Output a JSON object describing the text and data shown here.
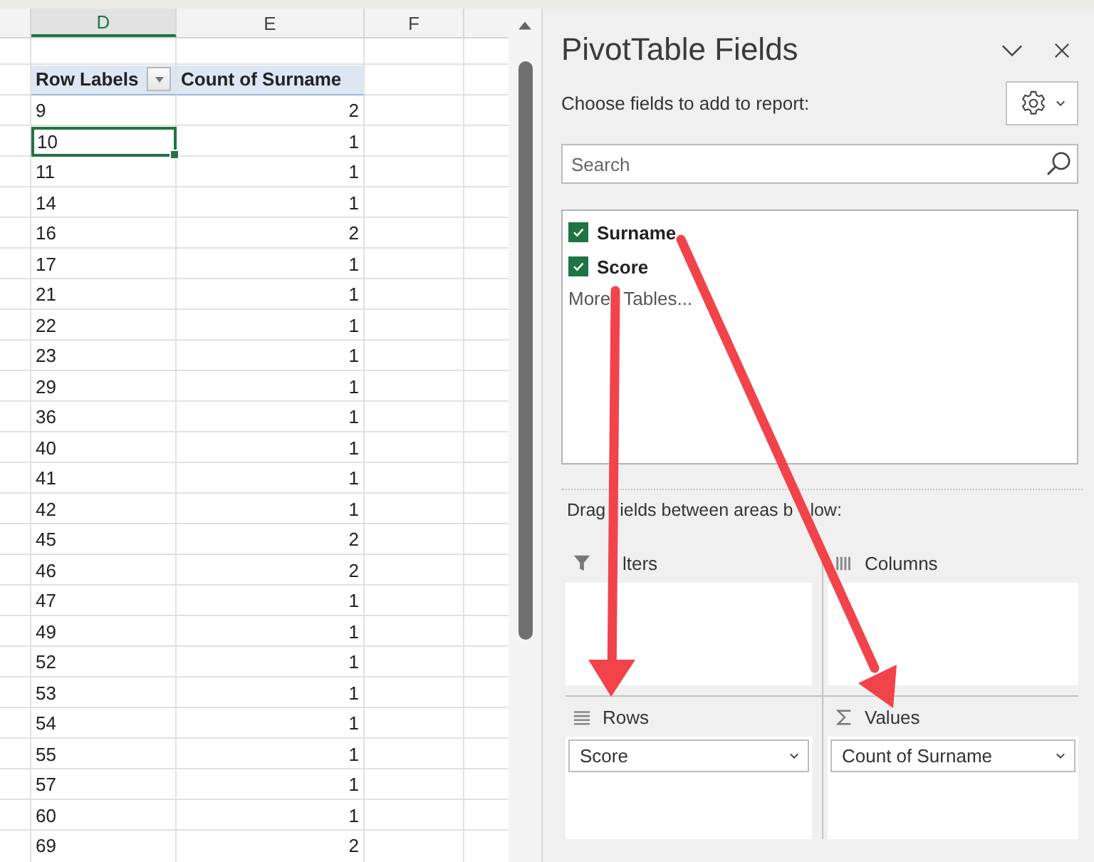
{
  "spreadsheet": {
    "column_headers": [
      {
        "label": "D",
        "selected": true
      },
      {
        "label": "E",
        "selected": false
      },
      {
        "label": "F",
        "selected": false
      }
    ],
    "pivot_table": {
      "row_labels_heading": "Row Labels",
      "value_heading": "Count of Surname",
      "rows": [
        {
          "label": "9",
          "count": "2",
          "selected": false
        },
        {
          "label": "10",
          "count": "1",
          "selected": true
        },
        {
          "label": "11",
          "count": "1",
          "selected": false
        },
        {
          "label": "14",
          "count": "1",
          "selected": false
        },
        {
          "label": "16",
          "count": "2",
          "selected": false
        },
        {
          "label": "17",
          "count": "1",
          "selected": false
        },
        {
          "label": "21",
          "count": "1",
          "selected": false
        },
        {
          "label": "22",
          "count": "1",
          "selected": false
        },
        {
          "label": "23",
          "count": "1",
          "selected": false
        },
        {
          "label": "29",
          "count": "1",
          "selected": false
        },
        {
          "label": "36",
          "count": "1",
          "selected": false
        },
        {
          "label": "40",
          "count": "1",
          "selected": false
        },
        {
          "label": "41",
          "count": "1",
          "selected": false
        },
        {
          "label": "42",
          "count": "1",
          "selected": false
        },
        {
          "label": "45",
          "count": "2",
          "selected": false
        },
        {
          "label": "46",
          "count": "2",
          "selected": false
        },
        {
          "label": "47",
          "count": "1",
          "selected": false
        },
        {
          "label": "49",
          "count": "1",
          "selected": false
        },
        {
          "label": "52",
          "count": "1",
          "selected": false
        },
        {
          "label": "53",
          "count": "1",
          "selected": false
        },
        {
          "label": "54",
          "count": "1",
          "selected": false
        },
        {
          "label": "55",
          "count": "1",
          "selected": false
        },
        {
          "label": "57",
          "count": "1",
          "selected": false
        },
        {
          "label": "60",
          "count": "1",
          "selected": false
        },
        {
          "label": "69",
          "count": "2",
          "selected": false
        }
      ]
    }
  },
  "pivot_fields": {
    "title": "PivotTable Fields",
    "instruction": "Choose fields to add to report:",
    "search": {
      "placeholder": "Search"
    },
    "fields": [
      {
        "name": "Surname",
        "checked": true
      },
      {
        "name": "Score",
        "checked": true
      }
    ],
    "more_tables": [
      "More",
      "Tables..."
    ],
    "areas_instruction": [
      "Drag",
      "ields between areas b",
      "low:"
    ],
    "areas": [
      {
        "kind": "filters",
        "label": "lters"
      },
      {
        "kind": "columns",
        "label": "Columns"
      },
      {
        "kind": "rows",
        "label": "Rows",
        "items": [
          "Score"
        ]
      },
      {
        "kind": "values",
        "label": "Values",
        "items": [
          "Count of Surname"
        ]
      }
    ]
  }
}
